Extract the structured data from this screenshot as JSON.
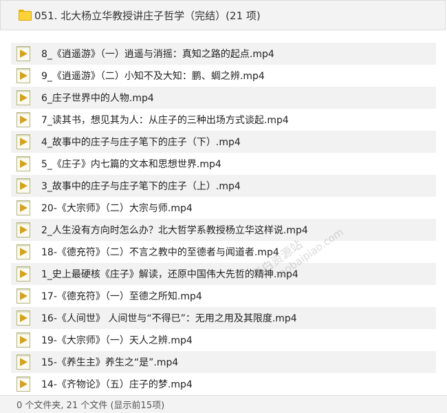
{
  "header": {
    "title": "051. 北大杨立华教授讲庄子哲学（完结）(21 项)"
  },
  "files": [
    {
      "name": "8_《逍遥游》（一）逍遥与消摇：真知之路的起点.mp4"
    },
    {
      "name": "9_《逍遥游》（二）小知不及大知：鹏、蜩之辨.mp4"
    },
    {
      "name": "6_庄子世界中的人物.mp4"
    },
    {
      "name": "7_读其书，想见其为人：从庄子的三种出场方式谈起.mp4"
    },
    {
      "name": "4_故事中的庄子与庄子笔下的庄子（下）.mp4"
    },
    {
      "name": "5_《庄子》内七篇的文本和思想世界.mp4"
    },
    {
      "name": "3_故事中的庄子与庄子笔下的庄子（上）.mp4"
    },
    {
      "name": "20-《大宗师》（二）大宗与师.mp4"
    },
    {
      "name": "2_人生没有方向时怎么办？北大哲学系教授杨立华这样说.mp4"
    },
    {
      "name": "18-《德充符》（二）不言之教中的至德者与闻道者.mp4"
    },
    {
      "name": "1_史上最硬核《庄子》解读，还原中国伟大先哲的精神.mp4"
    },
    {
      "name": "17-《德充符》（一）至德之所知.mp4"
    },
    {
      "name": "16-《人间世》 人间世与“不得已”：无用之用及其限度.mp4"
    },
    {
      "name": "19-《大宗师》（一）天人之辨.mp4"
    },
    {
      "name": "15-《养生主》养生之“是”.mp4"
    },
    {
      "name": "14-《齐物论》（五）庄子的梦.mp4"
    }
  ],
  "footer": {
    "status": "0 个文件夹, 21 个文件 (显示前15项)"
  },
  "watermark": {
    "line1": "老白资源站",
    "line2": "laobaipiao.com"
  },
  "colors": {
    "header_bg": "#f3f3f3",
    "row_alt": "#f2f2f2",
    "folder": "#ffd23c",
    "play_icon": "#d6a21e"
  }
}
